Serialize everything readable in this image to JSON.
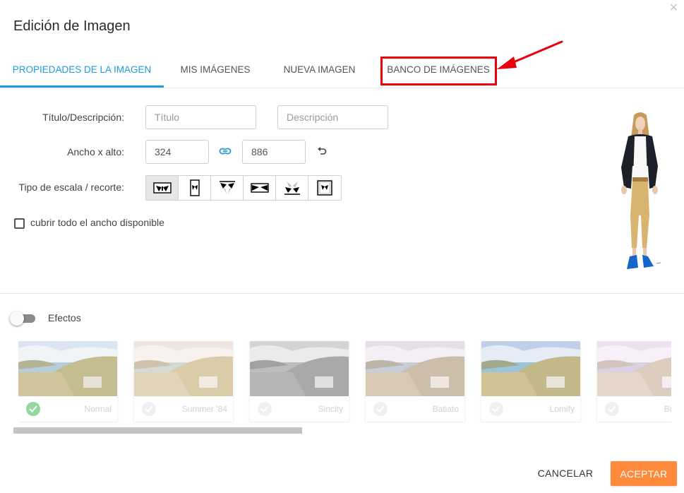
{
  "dialog": {
    "title": "Edición de Imagen",
    "close_icon": "close-icon"
  },
  "tabs": [
    {
      "label": "PROPIEDADES DE LA IMAGEN",
      "active": true
    },
    {
      "label": "MIS IMÁGENES",
      "active": false
    },
    {
      "label": "NUEVA IMAGEN",
      "active": false
    },
    {
      "label": "BANCO DE IMÁGENES",
      "active": false,
      "highlighted": true
    }
  ],
  "form": {
    "title_label": "Título/Descripción:",
    "title_placeholder": "Título",
    "description_placeholder": "Descripción",
    "size_label": "Ancho x alto:",
    "width_value": "324",
    "height_value": "886",
    "scale_label": "Tipo de escala / recorte:",
    "scale_options": [
      "scale-fit-icon",
      "scale-fit-height-icon",
      "scale-crop-top-icon",
      "scale-stretch-icon",
      "scale-crop-bottom-icon",
      "scale-original-icon"
    ],
    "scale_selected_index": 0,
    "cover_width_label": "cubrir todo el ancho disponible",
    "cover_width_checked": false
  },
  "effects": {
    "label": "Efectos",
    "enabled": false,
    "items": [
      {
        "name": "Normal",
        "selected": true
      },
      {
        "name": "Summer '84",
        "selected": false
      },
      {
        "name": "Sincity",
        "selected": false
      },
      {
        "name": "Batiato",
        "selected": false
      },
      {
        "name": "Lomify",
        "selected": false
      },
      {
        "name": "Bubble",
        "selected": false
      }
    ]
  },
  "footer": {
    "cancel_label": "CANCELAR",
    "accept_label": "ACEPTAR"
  },
  "colors": {
    "accent": "#1e9be0",
    "accept_button": "#ff8a3c",
    "highlight_box": "#e8000a",
    "selected_check": "#5cc36a"
  }
}
